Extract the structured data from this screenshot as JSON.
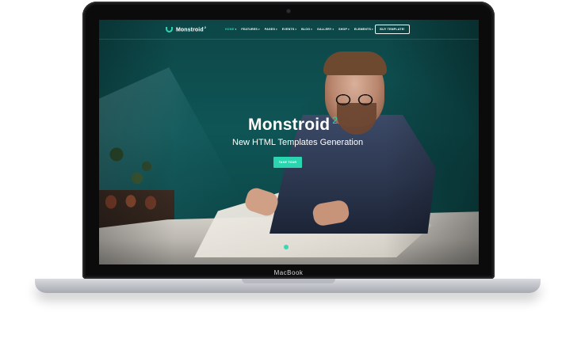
{
  "device": {
    "brand_label": "MacBook"
  },
  "site": {
    "logo": {
      "name": "Monstroid",
      "sup": "2",
      "icon": "shield-logo-icon"
    },
    "nav": {
      "items": [
        {
          "label": "HOME"
        },
        {
          "label": "FEATURES"
        },
        {
          "label": "PAGES"
        },
        {
          "label": "EVENTS"
        },
        {
          "label": "BLOG"
        },
        {
          "label": "GALLERY"
        },
        {
          "label": "SHOP"
        },
        {
          "label": "ELEMENTS"
        }
      ],
      "caret_icon": "chevron-down-icon",
      "caret_glyph": "▾",
      "active_index": 0
    },
    "header_cta": {
      "label": "BUY TEMPLATE!"
    },
    "hero": {
      "title": "Monstroid",
      "title_sup": "2",
      "subtitle": "New HTML Templates Generation",
      "cta": {
        "label": "TAKE TOUR"
      }
    },
    "colors": {
      "accent": "#2ad5b0",
      "background": "#0e4b4c",
      "text": "#ffffff"
    }
  }
}
